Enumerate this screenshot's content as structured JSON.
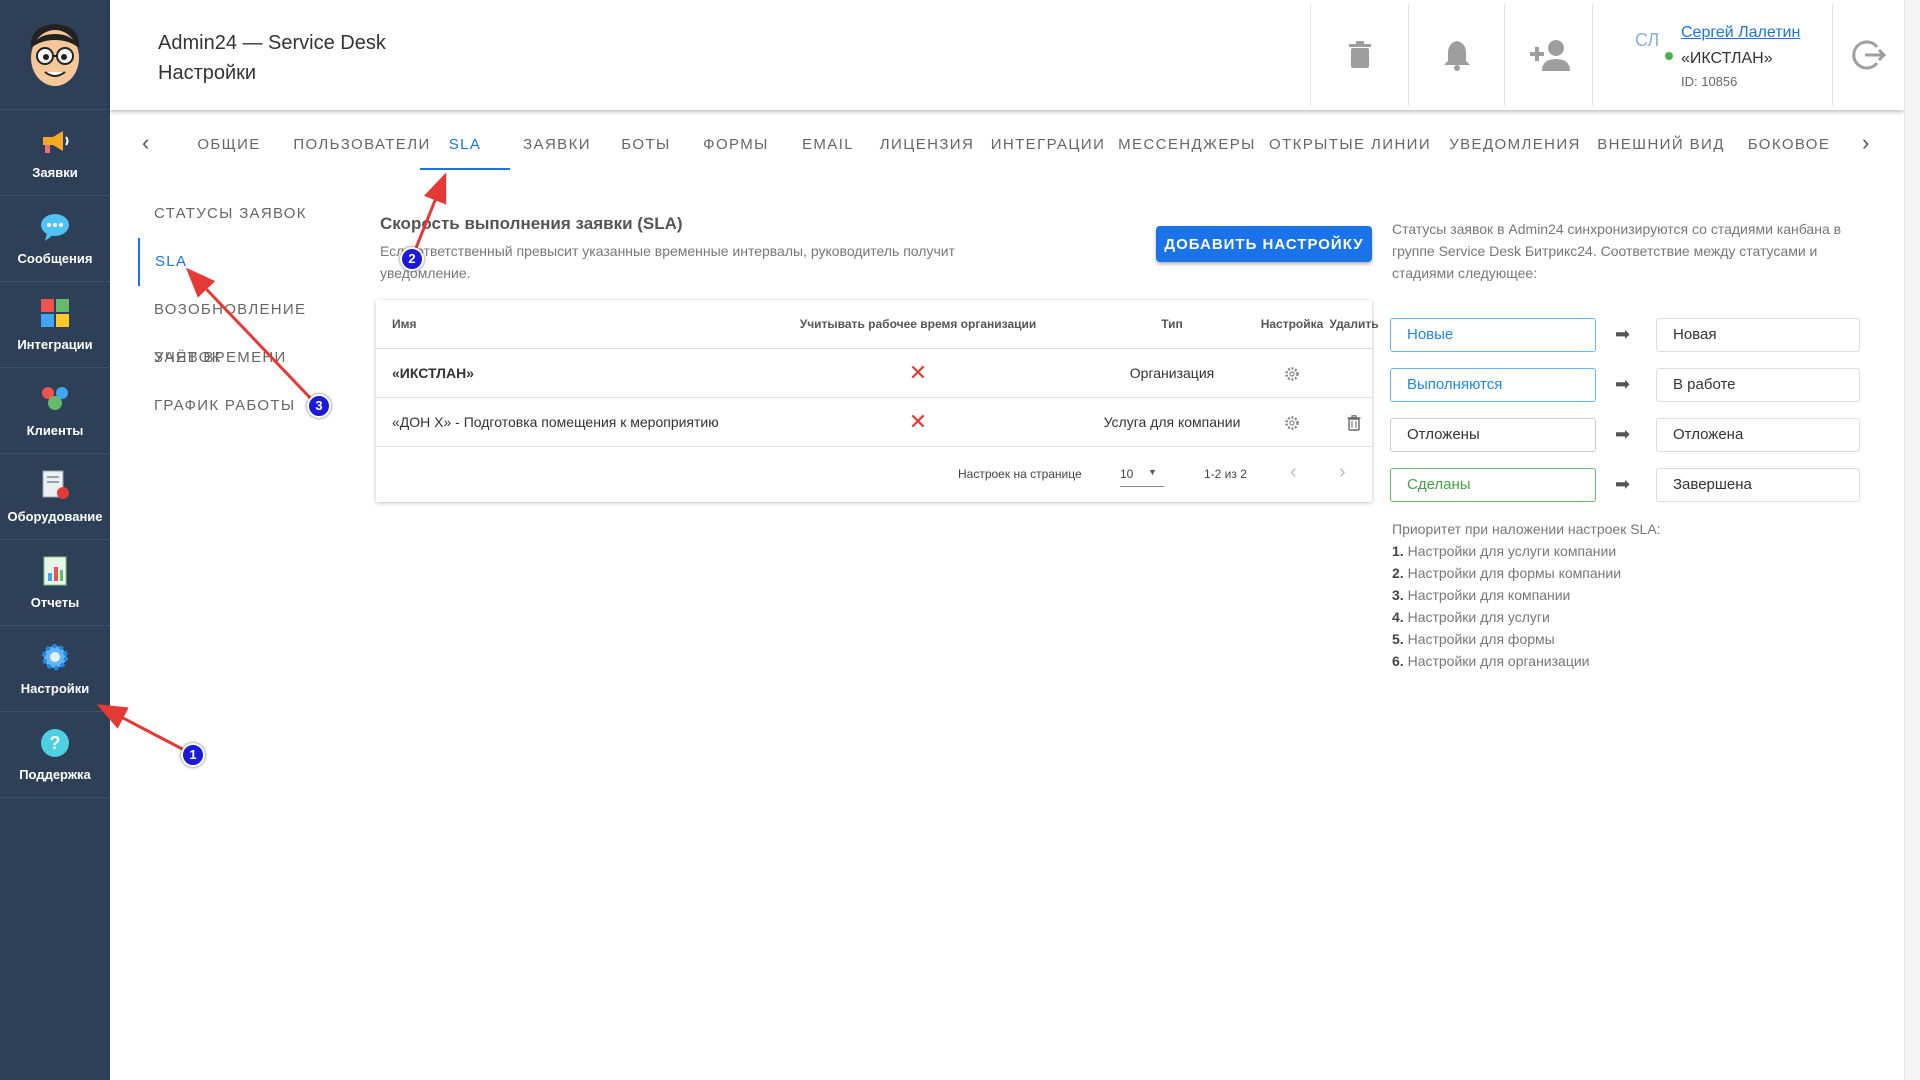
{
  "nav": {
    "items": [
      {
        "label": "Заявки",
        "icon": "megaphone-icon"
      },
      {
        "label": "Сообщения",
        "icon": "chat-bubble-icon"
      },
      {
        "label": "Интеграции",
        "icon": "puzzle-icon"
      },
      {
        "label": "Клиенты",
        "icon": "people-icon"
      },
      {
        "label": "Оборудование",
        "icon": "equipment-icon"
      },
      {
        "label": "Отчеты",
        "icon": "report-icon"
      },
      {
        "label": "Настройки",
        "icon": "gear-icon"
      },
      {
        "label": "Поддержка",
        "icon": "help-icon"
      }
    ]
  },
  "header": {
    "title_line1": "Admin24 — Service Desk",
    "title_line2": "Настройки",
    "user": {
      "initials": "СЛ",
      "name": "Сергей Лалетин",
      "org": "«ИКСТЛАН»",
      "id": "ID: 10856"
    }
  },
  "tabs": [
    {
      "label": "ОБЩИЕ"
    },
    {
      "label": "ПОЛЬЗОВАТЕЛИ"
    },
    {
      "label": "SLA",
      "active": true
    },
    {
      "label": "ЗАЯВКИ"
    },
    {
      "label": "БОТЫ"
    },
    {
      "label": "ФОРМЫ"
    },
    {
      "label": "EMAIL"
    },
    {
      "label": "ЛИЦЕНЗИЯ"
    },
    {
      "label": "ИНТЕГРАЦИИ"
    },
    {
      "label": "МЕССЕНДЖЕРЫ"
    },
    {
      "label": "ОТКРЫТЫЕ ЛИНИИ"
    },
    {
      "label": "УВЕДОМЛЕНИЯ"
    },
    {
      "label": "ВНЕШНИЙ ВИД"
    },
    {
      "label": "БОКОВОЕ"
    }
  ],
  "side_menu": [
    {
      "label": "СТАТУСЫ ЗАЯВОК"
    },
    {
      "label": "SLA",
      "active": true
    },
    {
      "label": "ВОЗОБНОВЛЕНИЕ ЗАЯВОК"
    },
    {
      "label": "УЧЁТ ВРЕМЕНИ"
    },
    {
      "label": "ГРАФИК РАБОТЫ"
    }
  ],
  "section": {
    "title": "Скорость выполнения заявки (SLA)",
    "description": "Если ответственный превысит указанные временные интервалы, руководитель получит уведомление.",
    "add_button": "ДОБАВИТЬ НАСТРОЙКУ"
  },
  "table": {
    "headers": {
      "name": "Имя",
      "worktime": "Учитывать рабочее время организации",
      "type": "Тип",
      "settings": "Настройка",
      "delete": "Удалить"
    },
    "rows": [
      {
        "name": "«ИКСТЛАН»",
        "worktime": "✕",
        "type": "Организация"
      },
      {
        "name": "«ДОН Х» - Подготовка помещения к мероприятию",
        "worktime": "✕",
        "type": "Услуга для компании"
      }
    ],
    "footer": {
      "per_page_label": "Настроек на странице",
      "per_page_value": "10",
      "range": "1-2 из 2"
    }
  },
  "right_panel": {
    "info": "Статусы заявок в Admin24 синхронизируются со стадиями канбана в группе Service Desk Битрикс24. Соответствие между статусами и стадиями следующее:",
    "mappings": [
      {
        "from": "Новые",
        "to": "Новая",
        "color": "#1e88e5",
        "border": "#64b5f6"
      },
      {
        "from": "Выполняются",
        "to": "В работе",
        "color": "#1e88e5",
        "border": "#64b5f6"
      },
      {
        "from": "Отложены",
        "to": "Отложена",
        "color": "#333333",
        "border": "#cccccc"
      },
      {
        "from": "Сделаны",
        "to": "Завершена",
        "color": "#43a047",
        "border": "#66bb6a"
      }
    ],
    "priority_title": "Приоритет при наложении настроек SLA:",
    "priority": [
      {
        "num": "1.",
        "text": "Настройки для услуги компании"
      },
      {
        "num": "2.",
        "text": "Настройки для формы компании"
      },
      {
        "num": "3.",
        "text": "Настройки для компании"
      },
      {
        "num": "4.",
        "text": "Настройки для услуги"
      },
      {
        "num": "5.",
        "text": "Настройки для формы"
      },
      {
        "num": "6.",
        "text": "Настройки для организации"
      }
    ]
  },
  "annotations": [
    {
      "label": "1"
    },
    {
      "label": "2"
    },
    {
      "label": "3"
    }
  ],
  "colors": {
    "accent": "#1a73e8",
    "nav_bg": "#2e4057",
    "annotation_arrow": "#e53935",
    "annotation_badge": "#1a1ad8"
  }
}
